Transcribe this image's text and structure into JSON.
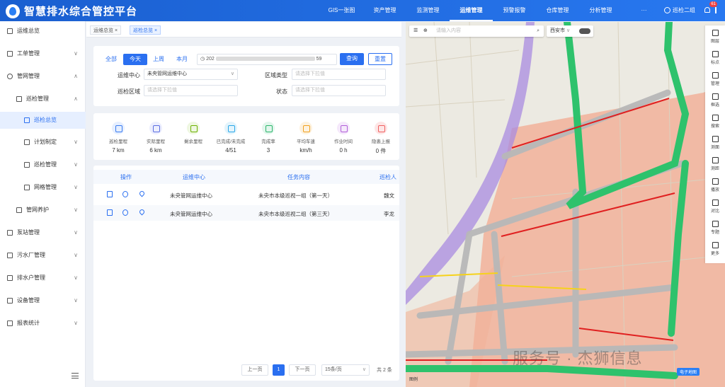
{
  "app": {
    "title": "智慧排水综合管控平台"
  },
  "nav": {
    "items": [
      "GIS一张图",
      "资产管理",
      "监测管理",
      "运维管理",
      "预警报警",
      "仓库管理",
      "分析管理",
      "···"
    ],
    "active": "运维管理"
  },
  "user": {
    "name": "巡检二组",
    "badge": "61"
  },
  "sidebar": {
    "items": [
      {
        "label": "运维总览",
        "level": 0
      },
      {
        "label": "工单管理",
        "level": 0,
        "chev": "∨"
      },
      {
        "label": "管网管理",
        "level": 0,
        "chev": "∧"
      },
      {
        "label": "巡检管理",
        "level": 1,
        "chev": "∧"
      },
      {
        "label": "巡检总览",
        "level": 2,
        "active": true
      },
      {
        "label": "计划制定",
        "level": 2,
        "chev": "∨"
      },
      {
        "label": "巡检管理",
        "level": 2,
        "chev": "∨"
      },
      {
        "label": "网格管理",
        "level": 2,
        "chev": "∨"
      },
      {
        "label": "管网养护",
        "level": 1,
        "chev": "∨"
      },
      {
        "label": "泵站管理",
        "level": 0,
        "chev": "∨"
      },
      {
        "label": "污水厂管理",
        "level": 0,
        "chev": "∨"
      },
      {
        "label": "排水户管理",
        "level": 0,
        "chev": "∨"
      },
      {
        "label": "设备管理",
        "level": 0,
        "chev": "∨"
      },
      {
        "label": "报表统计",
        "level": 0,
        "chev": "∨"
      }
    ]
  },
  "tabs": [
    {
      "label": "运维总览"
    },
    {
      "label": "巡检总览"
    }
  ],
  "filter": {
    "quick": [
      "全部",
      "今天",
      "上周",
      "本月"
    ],
    "quick_active": "今天",
    "date_start": "202",
    "date_end": "59",
    "search_label": "查询",
    "reset_label": "重置",
    "center_label": "运维中心",
    "center_value": "未央管网运维中心",
    "area_type_label": "区域类型",
    "area_type_placeholder": "请选择下拉值",
    "area_label": "巡检区域",
    "area_placeholder": "请选择下拉值",
    "status_label": "状态",
    "status_placeholder": "请选择下拉值"
  },
  "stats": [
    {
      "label": "巡检里程",
      "value": "7 km",
      "color": "#3a7cf0",
      "bg": "#e6efff"
    },
    {
      "label": "实际里程",
      "value": "6 km",
      "color": "#5b6ee0",
      "bg": "#eceefe"
    },
    {
      "label": "剩余里程",
      "value": "",
      "color": "#6bb000",
      "bg": "#eef7e0"
    },
    {
      "label": "已完成/未完成",
      "value": "4/51",
      "color": "#2aa7e8",
      "bg": "#e3f4fc"
    },
    {
      "label": "完成率",
      "value": "3",
      "color": "#2bb56b",
      "bg": "#e2f6ec"
    },
    {
      "label": "平均车速",
      "value": "km/h",
      "color": "#f0a020",
      "bg": "#fdf2df"
    },
    {
      "label": "作业时间",
      "value": "0 h",
      "color": "#b05ed8",
      "bg": "#f5e8fb"
    },
    {
      "label": "隐患上报",
      "value": "0 件",
      "color": "#f06060",
      "bg": "#fde6e6"
    }
  ],
  "table": {
    "headers": [
      "操作",
      "运维中心",
      "任务内容",
      "巡检人"
    ],
    "rows": [
      {
        "center": "未央管网运维中心",
        "task": "未央市本级巡视一组（第一天）",
        "inspector": "魏文"
      },
      {
        "center": "未央管网运维中心",
        "task": "未央市本级巡视二组（第三天）",
        "inspector": "李龙"
      }
    ]
  },
  "pagination": {
    "prev": "上一页",
    "page": "1",
    "next": "下一页",
    "size": "15条/页",
    "total": "共 2 条"
  },
  "map": {
    "search_placeholder": "请输入内容",
    "city": "西安市",
    "legend": "电子地图",
    "scale": "图例",
    "watermark": "服务号 · 杰狮信息",
    "tools": [
      "图层",
      "标点",
      "管理",
      "框选",
      "搜索",
      "测面",
      "测距",
      "播放",
      "对比",
      "专题",
      "更多"
    ]
  },
  "colors": {
    "primary": "#2a6ff0",
    "map_zone": "#f2b29a",
    "route_green": "#2ec26c",
    "route_gray": "#b8b8b8",
    "route_red": "#e02020",
    "route_yellow": "#f6d21a",
    "road_purple": "#a98be0"
  }
}
